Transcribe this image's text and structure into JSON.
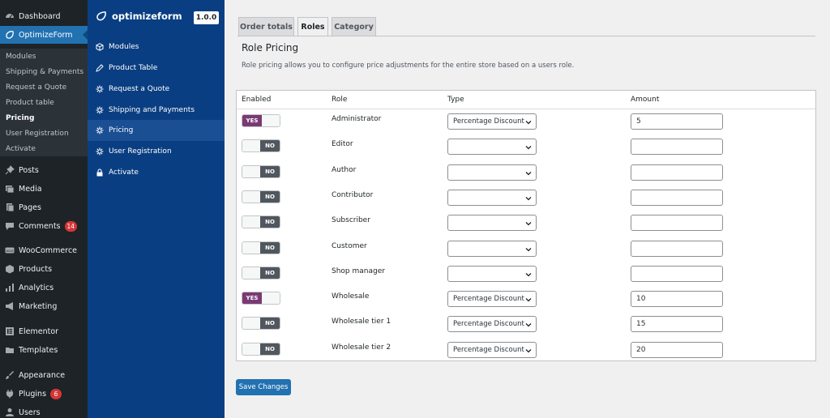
{
  "wp_menu": {
    "dashboard": "Dashboard",
    "optimizeform": "OptimizeForm",
    "submenu": [
      "Modules",
      "Shipping & Payments",
      "Request a Quote",
      "Product table",
      "Pricing",
      "User Registration",
      "Activate"
    ],
    "posts": "Posts",
    "media": "Media",
    "pages": "Pages",
    "comments": "Comments",
    "comments_count": "14",
    "woocommerce": "WooCommerce",
    "products": "Products",
    "analytics": "Analytics",
    "marketing": "Marketing",
    "elementor": "Elementor",
    "templates": "Templates",
    "appearance": "Appearance",
    "plugins": "Plugins",
    "plugins_count": "6",
    "users": "Users"
  },
  "plugin_nav": {
    "brand": "optimizeform",
    "version": "1.0.0",
    "items": [
      "Modules",
      "Product Table",
      "Request a Quote",
      "Shipping and Payments",
      "Pricing",
      "User Registration",
      "Activate"
    ]
  },
  "tabs": [
    "Order totals",
    "Roles",
    "Category"
  ],
  "page": {
    "title": "Role Pricing",
    "description": "Role pricing allows you to configure price adjustments for the entire store based on a users role."
  },
  "table": {
    "headers": [
      "Enabled",
      "Role",
      "Type",
      "Amount"
    ],
    "rows": [
      {
        "enabled": "YES",
        "role": "Administrator",
        "type": "Percentage Discount",
        "amount": "5"
      },
      {
        "enabled": "NO",
        "role": "Editor",
        "type": "",
        "amount": ""
      },
      {
        "enabled": "NO",
        "role": "Author",
        "type": "",
        "amount": ""
      },
      {
        "enabled": "NO",
        "role": "Contributor",
        "type": "",
        "amount": ""
      },
      {
        "enabled": "NO",
        "role": "Subscriber",
        "type": "",
        "amount": ""
      },
      {
        "enabled": "NO",
        "role": "Customer",
        "type": "",
        "amount": ""
      },
      {
        "enabled": "NO",
        "role": "Shop manager",
        "type": "",
        "amount": ""
      },
      {
        "enabled": "YES",
        "role": "Wholesale",
        "type": "Percentage Discount",
        "amount": "10"
      },
      {
        "enabled": "NO",
        "role": "Wholesale tier 1",
        "type": "Percentage Discount",
        "amount": "15"
      },
      {
        "enabled": "NO",
        "role": "Wholesale tier 2",
        "type": "Percentage Discount",
        "amount": "20"
      }
    ]
  },
  "save_label": "Save Changes",
  "colors": {
    "wp_sidebar": "#1d2327",
    "wp_accent": "#2271b1",
    "plugin_nav": "#0a3e82",
    "toggle_on": "#7a3a73",
    "toggle_off": "#50575e"
  }
}
